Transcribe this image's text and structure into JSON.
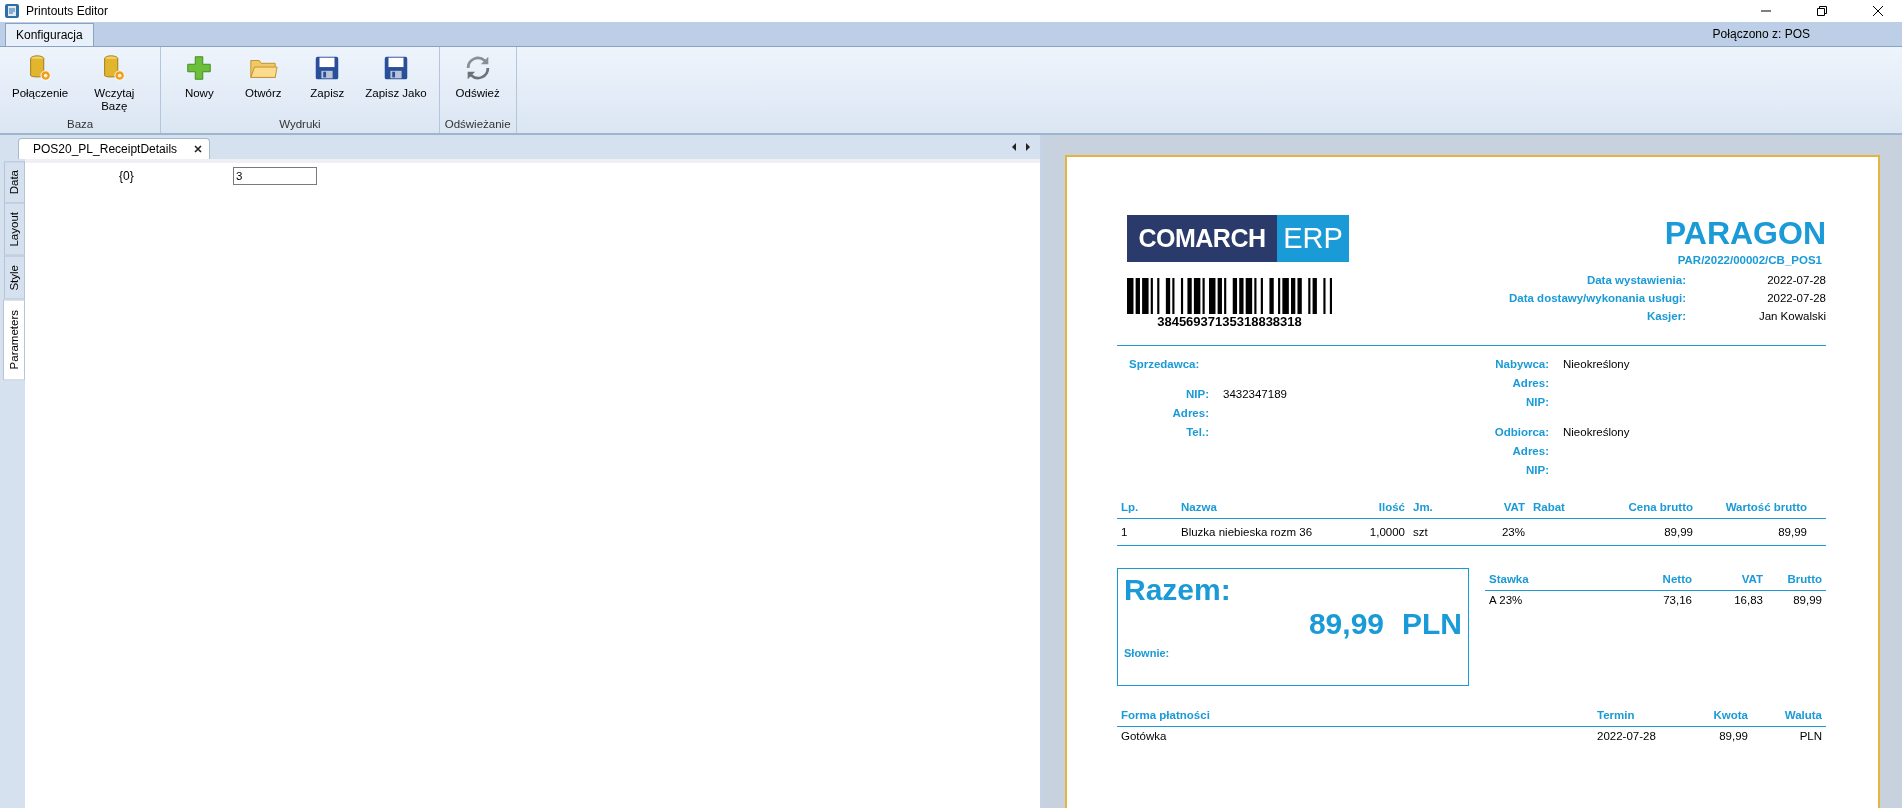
{
  "window": {
    "title": "Printouts Editor"
  },
  "ribbon": {
    "tabs": [
      {
        "label": "Konfiguracja",
        "selected": true
      }
    ],
    "connection": "Połączono z: POS",
    "groups": [
      {
        "label": "Baza",
        "buttons": [
          {
            "kind": "database",
            "label": "Połączenie"
          },
          {
            "kind": "database",
            "label": "Wczytaj Bazę"
          }
        ]
      },
      {
        "label": "Wydruki",
        "buttons": [
          {
            "kind": "new",
            "label": "Nowy"
          },
          {
            "kind": "open",
            "label": "Otwórz"
          },
          {
            "kind": "save",
            "label": "Zapisz"
          },
          {
            "kind": "save",
            "label": "Zapisz Jako"
          }
        ]
      },
      {
        "label": "Odświeżanie",
        "buttons": [
          {
            "kind": "refresh",
            "label": "Odśwież"
          }
        ]
      }
    ]
  },
  "document_tab": {
    "label": "POS20_PL_ReceiptDetails"
  },
  "side_tabs": [
    {
      "label": "Data",
      "selected": false
    },
    {
      "label": "Layout",
      "selected": false
    },
    {
      "label": "Style",
      "selected": false
    },
    {
      "label": "Parameters",
      "selected": true
    }
  ],
  "parameters": [
    {
      "label": "{0}",
      "value": "3"
    }
  ],
  "receipt": {
    "logo": {
      "left": "COMARCH",
      "right": "ERP"
    },
    "barcode_number": "38456937135318838318",
    "title": "PARAGON",
    "number": "PAR/2022/00002/CB_POS1",
    "header_fields": [
      {
        "label": "Data wystawienia:",
        "value": "2022-07-28"
      },
      {
        "label": "Data dostawy/wykonania usługi:",
        "value": "2022-07-28"
      },
      {
        "label": "Kasjer:",
        "value": "Jan Kowalski"
      }
    ],
    "seller": {
      "label": "Sprzedawca:",
      "rows": [
        {
          "label": "NIP:",
          "value": "3432347189"
        },
        {
          "label": "Adres:"
        },
        {
          "label": "Tel.:"
        }
      ]
    },
    "buyer": [
      {
        "label": "Nabywca:",
        "value": "Nieokreślony"
      },
      {
        "label": "Adres:"
      },
      {
        "label": "NIP:"
      }
    ],
    "recipient": [
      {
        "label": "Odbiorca:",
        "value": "Nieokreślony"
      },
      {
        "label": "Adres:"
      },
      {
        "label": "NIP:"
      }
    ],
    "items": {
      "columns": [
        "Lp.",
        "Nazwa",
        "Ilość",
        "Jm.",
        "VAT",
        "Rabat",
        "Cena brutto",
        "Wartość brutto"
      ],
      "rows": [
        [
          "1",
          "Bluzka niebieska rozm 36",
          "1,0000",
          "szt",
          "23%",
          null,
          "89,99",
          "89,99"
        ]
      ]
    },
    "total": {
      "label": "Razem:",
      "amount": "89,99",
      "currency": "PLN",
      "words_label": "Słownie:"
    },
    "vat": {
      "columns": [
        "Stawka",
        "Netto",
        "VAT",
        "Brutto"
      ],
      "rows": [
        [
          "A 23%",
          "73,16",
          "16,83",
          "89,99"
        ]
      ]
    },
    "payments": {
      "columns": [
        "Forma płatności",
        "Termin",
        "Kwota",
        "Waluta"
      ],
      "rows": [
        [
          "Gotówka",
          "2022-07-28",
          "89,99",
          "PLN"
        ]
      ]
    }
  }
}
